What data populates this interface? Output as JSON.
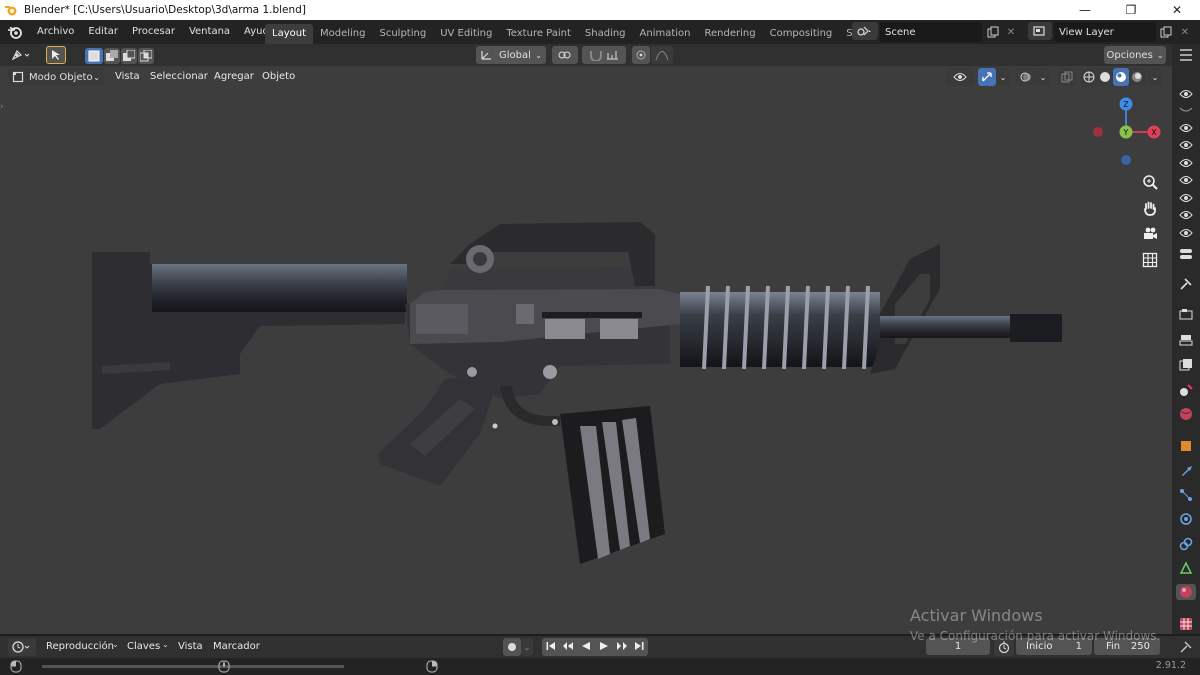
{
  "window": {
    "title": "Blender* [C:\\Users\\Usuario\\Desktop\\3d\\arma 1.blend]",
    "minimize": "—",
    "maximize": "❐",
    "close": "✕"
  },
  "menu": {
    "items": [
      "Archivo",
      "Editar",
      "Procesar",
      "Ventana",
      "Ayuda"
    ]
  },
  "workspaces": {
    "tabs": [
      "Layout",
      "Modeling",
      "Sculpting",
      "UV Editing",
      "Texture Paint",
      "Shading",
      "Animation",
      "Rendering",
      "Compositing",
      "Scripi"
    ],
    "active": "Layout"
  },
  "scene": {
    "name": "Scene",
    "view_layer": "View Layer"
  },
  "viewport_header": {
    "transform_orientation": "Global",
    "options_label": "Opciones",
    "mode": "Modo Objeto",
    "menus": [
      "Vista",
      "Seleccionar",
      "Agregar",
      "Objeto"
    ]
  },
  "gizmo": {
    "z": "Z",
    "y": "Y",
    "x": "X"
  },
  "timeline": {
    "menus": [
      "Reproducción",
      "Claves",
      "Vista",
      "Marcador"
    ],
    "current_frame": "1",
    "start_label": "Inicio",
    "start": "1",
    "end_label": "Fin",
    "end": "250"
  },
  "status": {
    "version": "2.91.2"
  },
  "watermark": {
    "line1": "Activar Windows",
    "line2": "Ve a Configuración para activar Windows."
  },
  "colors": {
    "accent": "#4772b3",
    "viewport_bg": "#3d3d3d",
    "header_bg": "#303030",
    "gizmo_x": "#e0405a",
    "gizmo_y": "#8bc34a",
    "gizmo_z": "#3f8fe8"
  }
}
